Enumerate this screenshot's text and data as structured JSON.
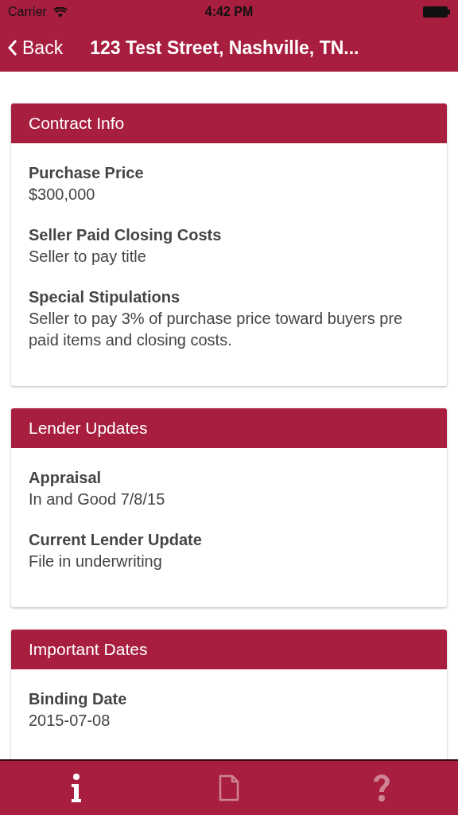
{
  "status_bar": {
    "carrier": "Carrier",
    "time": "4:42 PM"
  },
  "nav_bar": {
    "back": "Back",
    "title": "123 Test Street, Nashville, TN..."
  },
  "sections": [
    {
      "title": "Contract Info",
      "fields": [
        {
          "label": "Purchase Price",
          "value": "$300,000"
        },
        {
          "label": "Seller Paid Closing Costs",
          "value": "Seller to pay title"
        },
        {
          "label": "Special Stipulations",
          "value": "Seller to pay 3% of purchase price toward buyers pre paid items and closing costs."
        }
      ]
    },
    {
      "title": "Lender Updates",
      "fields": [
        {
          "label": "Appraisal",
          "value": "In and Good 7/8/15"
        },
        {
          "label": "Current Lender Update",
          "value": "File in underwriting"
        }
      ]
    },
    {
      "title": "Important Dates",
      "fields": [
        {
          "label": "Binding Date",
          "value": "2015-07-08"
        }
      ]
    }
  ],
  "tab_bar": [
    {
      "kind": "info",
      "selected": true
    },
    {
      "kind": "document",
      "selected": false
    },
    {
      "kind": "help",
      "selected": false
    }
  ]
}
